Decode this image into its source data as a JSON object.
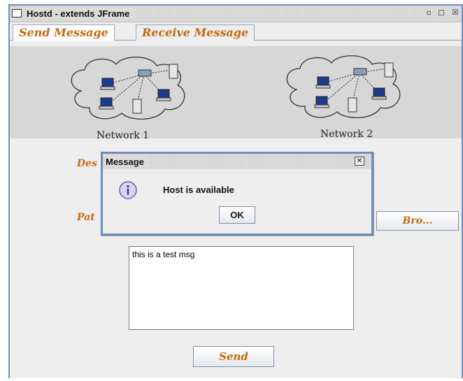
{
  "window": {
    "title": "Hostd - extends JFrame",
    "controls": {
      "minimize": "▫",
      "maximize": "□",
      "close": "☒"
    }
  },
  "tabs": [
    {
      "label": "Send Message",
      "active": true
    },
    {
      "label": "Receive Message",
      "active": false
    }
  ],
  "networks": [
    {
      "label": "Network 1"
    },
    {
      "label": "Network 2"
    }
  ],
  "form": {
    "destination_label_partial": "Des",
    "path_label_partial": "Pat",
    "browse_label": "Bro...",
    "message_text": "this is a test msg",
    "send_label": "Send"
  },
  "dialog": {
    "title": "Message",
    "message": "Host is available",
    "ok_label": "OK",
    "icon": "info-icon"
  },
  "colors": {
    "accent": "#c46a10",
    "frame_border": "#6f8db9",
    "panel": "#eeeeee"
  }
}
